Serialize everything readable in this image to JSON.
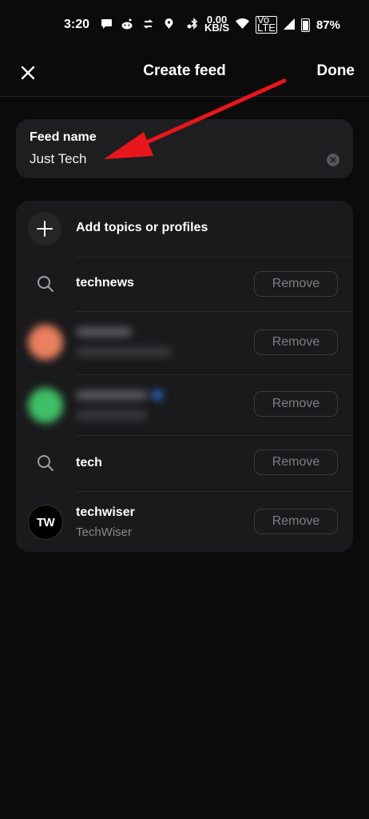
{
  "status_bar": {
    "time": "3:20",
    "net_speed_value": "0.00",
    "net_speed_unit": "KB/S",
    "volte_top": "Vo",
    "volte_bottom": "LTE",
    "battery": "87%"
  },
  "header": {
    "title": "Create feed",
    "done_label": "Done"
  },
  "feed_name": {
    "label": "Feed name",
    "value": "Just Tech"
  },
  "list": {
    "add_label": "Add topics or profiles",
    "items": [
      {
        "type": "topic",
        "label": "technews",
        "remove_label": "Remove"
      },
      {
        "type": "profile-blurred",
        "avatar_color": "#e9805f",
        "remove_label": "Remove"
      },
      {
        "type": "profile-blurred",
        "avatar_color": "#3fbf66",
        "remove_label": "Remove"
      },
      {
        "type": "topic",
        "label": "tech",
        "remove_label": "Remove"
      },
      {
        "type": "profile",
        "label": "techwiser",
        "sub": "TechWiser",
        "avatar_text": "TW",
        "remove_label": "Remove"
      }
    ]
  },
  "colors": {
    "background": "#0b0b0c",
    "card": "#1a1a1c",
    "annotation_arrow": "#e8161b"
  }
}
